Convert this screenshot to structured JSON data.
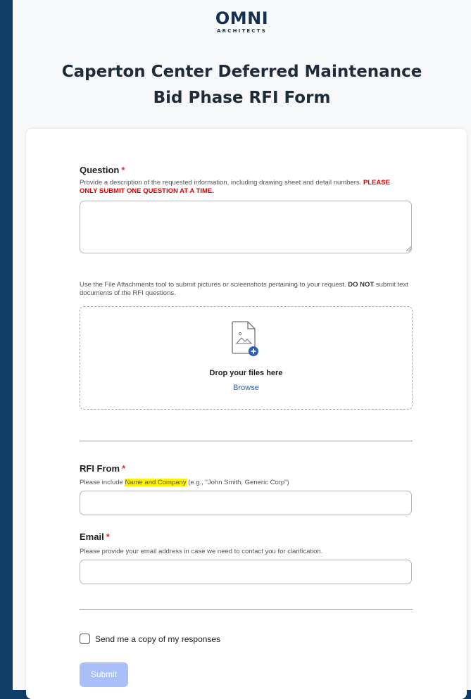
{
  "header": {
    "logo_main": "OMNI",
    "logo_sub": "ARCHITECTS",
    "title_line1": "Caperton Center Deferred Maintenance",
    "title_line2": "Bid Phase RFI Form"
  },
  "question": {
    "label": "Question",
    "required_mark": "*",
    "help": "Provide a description of the requested information, including drawing sheet and detail numbers.",
    "help_emphasis": "PLEASE ONLY SUBMIT ONE QUESTION AT A TIME.",
    "value": ""
  },
  "attachments": {
    "help_start": "Use the File Attachments tool to submit pictures or screenshots pertaining to your request.",
    "help_bold": "DO NOT",
    "help_end": "submit text documents of the RFI questions.",
    "drop_text": "Drop your files here",
    "browse_label": "Browse",
    "icon": "image-file-add-icon",
    "accent": "#2b5fb4"
  },
  "rfi_from": {
    "label": "RFI From",
    "required_mark": "*",
    "help_start": "Please include",
    "help_highlight": "Name and Company",
    "help_end": "(e.g., \"John Smith, Generic Corp\")",
    "value": ""
  },
  "email": {
    "label": "Email",
    "required_mark": "*",
    "help": "Please provide your email address in case we need to contact you for clarification.",
    "value": ""
  },
  "copy_checkbox": {
    "label": "Send me a copy of my responses",
    "checked": false
  },
  "submit": {
    "label": "Submit",
    "color": "#a9bffa"
  },
  "colors": {
    "background": "#0f3d66",
    "required": "#e0302a",
    "highlight": "#fff200"
  }
}
